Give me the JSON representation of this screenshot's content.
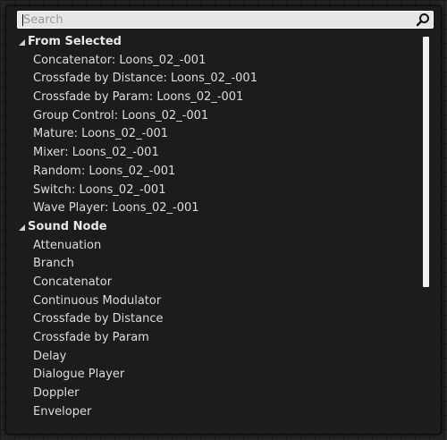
{
  "search": {
    "placeholder": "Search",
    "value": ""
  },
  "icons": {
    "search": "search-icon",
    "category_expand": "triangle-down-right-icon"
  },
  "categories": [
    {
      "label": "From Selected",
      "items": [
        "Concatenator: Loons_02_-001",
        "Crossfade by Distance: Loons_02_-001",
        "Crossfade by Param: Loons_02_-001",
        "Group Control: Loons_02_-001",
        "Mature: Loons_02_-001",
        "Mixer: Loons_02_-001",
        "Random: Loons_02_-001",
        "Switch: Loons_02_-001",
        "Wave Player: Loons_02_-001"
      ]
    },
    {
      "label": "Sound Node",
      "items": [
        "Attenuation",
        "Branch",
        "Concatenator",
        "Continuous Modulator",
        "Crossfade by Distance",
        "Crossfade by Param",
        "Delay",
        "Dialogue Player",
        "Doppler",
        "Enveloper"
      ]
    }
  ],
  "colors": {
    "background": "#262626",
    "panel": "#1c1c1c",
    "text": "#dcdcdc",
    "search_bg": "#e6e6e6"
  }
}
